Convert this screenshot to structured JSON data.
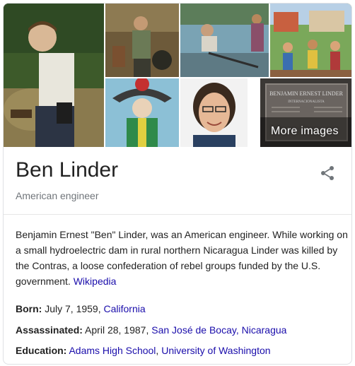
{
  "gallery": {
    "more_images_label": "More images",
    "plaque_text_line1": "BENJAMIN ERNEST LINDER",
    "plaque_text_line2": "INTERNACIONALISTA"
  },
  "entity": {
    "name": "Ben Linder",
    "subtitle": "American engineer"
  },
  "description": {
    "text": "Benjamin Ernest \"Ben\" Linder, was an American engineer. While working on a small hydroelectric dam in rural northern Nicaragua Linder was killed by the Contras, a loose confederation of rebel groups funded by the U.S. government. ",
    "source_link": "Wikipedia"
  },
  "facts": {
    "born": {
      "label": "Born:",
      "value": " July 7, 1959, ",
      "link1": "California"
    },
    "assassinated": {
      "label": "Assassinated:",
      "value": " April 28, 1987, ",
      "link1": "San José de Bocay, Nicaragua"
    },
    "education": {
      "label": "Education:",
      "value": " ",
      "link1": "Adams High School",
      "sep": ", ",
      "link2": "University of Washington"
    }
  },
  "colors": {
    "link": "#1a0dab",
    "muted": "#70757a",
    "text": "#222222"
  },
  "icons": {
    "share": "share-icon"
  }
}
